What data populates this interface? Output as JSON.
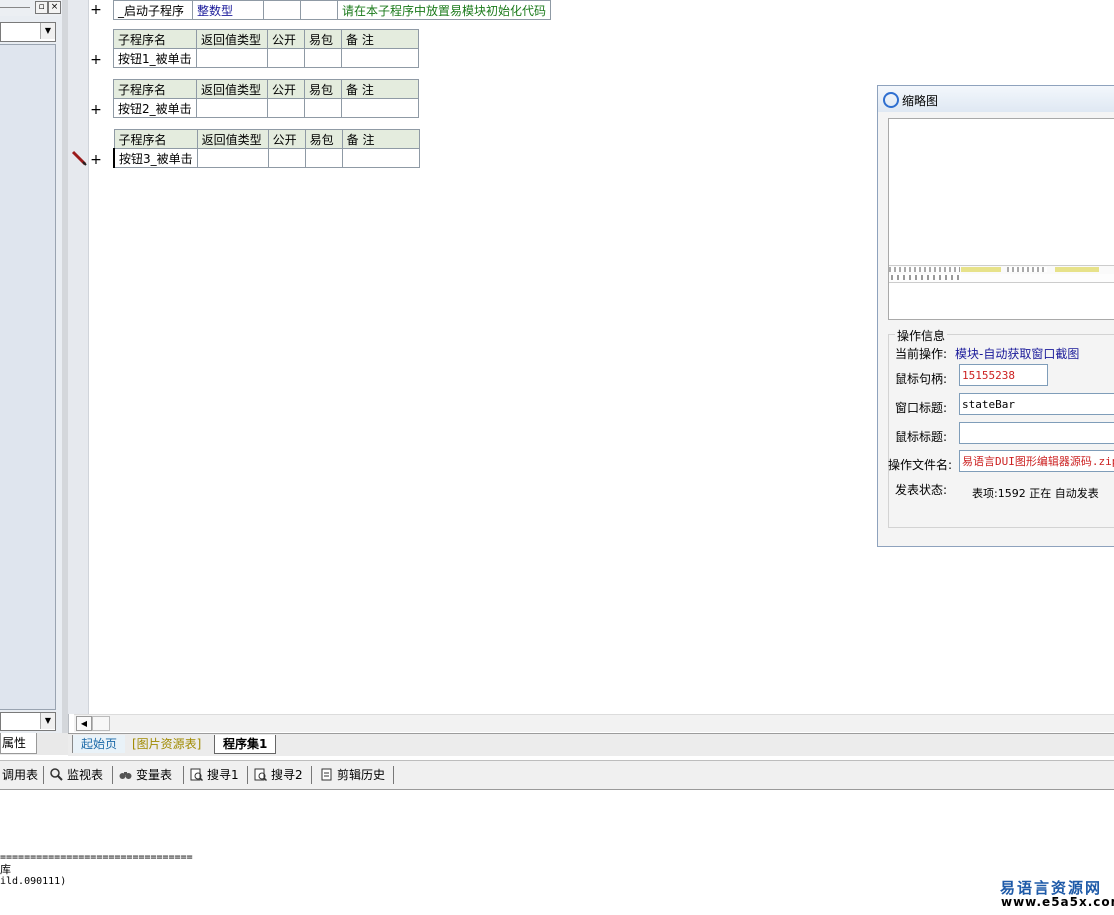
{
  "left_panel": {
    "tab_label": "属性"
  },
  "tables": [
    {
      "rows": [
        [
          "_启动子程序",
          "整数型",
          "",
          "",
          "请在本子程序中放置易模块初始化代码"
        ]
      ]
    },
    {
      "headers": [
        "子程序名",
        "返回值类型",
        "公开",
        "易包",
        "备 注"
      ],
      "rows": [
        [
          "按钮1_被单击",
          "",
          "",
          "",
          ""
        ]
      ]
    },
    {
      "headers": [
        "子程序名",
        "返回值类型",
        "公开",
        "易包",
        "备 注"
      ],
      "rows": [
        [
          "按钮2_被单击",
          "",
          "",
          "",
          ""
        ]
      ]
    },
    {
      "headers": [
        "子程序名",
        "返回值类型",
        "公开",
        "易包",
        "备 注"
      ],
      "rows": [
        [
          "按钮3_被单击",
          "",
          "",
          "",
          ""
        ]
      ]
    }
  ],
  "editor": {
    "plus_symbol": "+"
  },
  "doc_tabs": [
    "起始页",
    "[图片资源表]",
    "程序集1"
  ],
  "bottom_toolbar": [
    "调用表",
    "监视表",
    "变量表",
    "搜寻1",
    "搜寻2",
    "剪辑历史"
  ],
  "output": {
    "line1": "================================",
    "line2": "库",
    "line3": "ild.090111)"
  },
  "thumbnail_window": {
    "title": "缩略图",
    "group_label": "操作信息",
    "current_op_label": "当前操作:",
    "current_op_value": "模块-自动获取窗口截图",
    "mouse_handle_label": "鼠标句柄:",
    "mouse_handle_value": "15155238",
    "window_title_label": "窗口标题:",
    "window_title_value": "stateBar",
    "mouse_title_label": "鼠标标题:",
    "mouse_title_value": "",
    "op_file_label": "操作文件名:",
    "op_file_value": "易语言DUI图形编辑器源码.zip",
    "post_status_label": "发表状态:",
    "post_status_value": "表项:1592 正在 自动发表"
  },
  "watermark": {
    "line1": "易语言资源网",
    "line2": "www.e5a5x.com"
  },
  "colors": {
    "accent_blue": "#1c6aa8",
    "red_value": "#cc2222",
    "green_comment": "#1a7a1a",
    "navy_type": "#1a1a9a"
  }
}
